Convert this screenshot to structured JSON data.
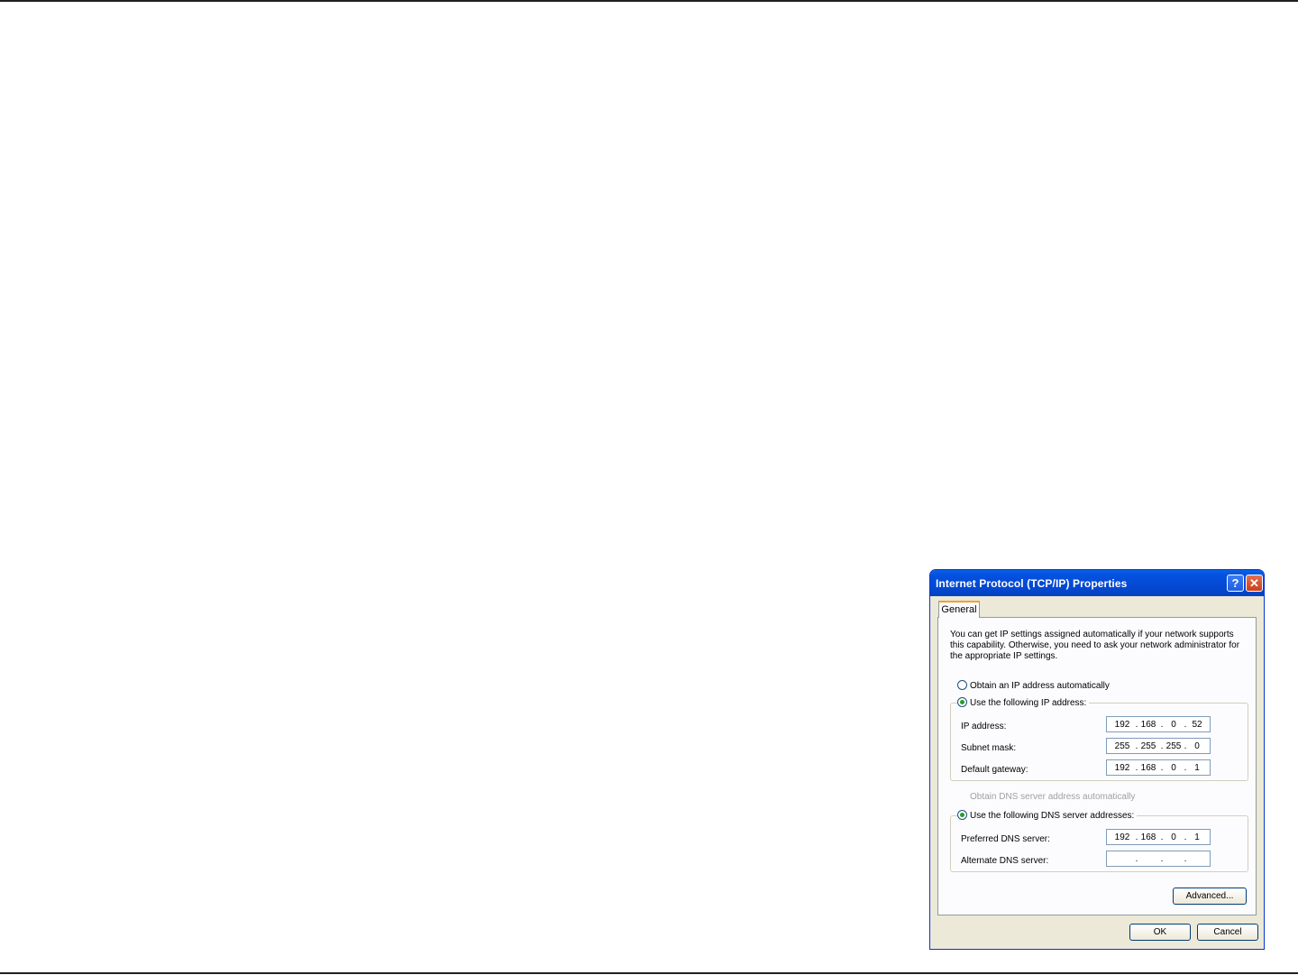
{
  "dialog": {
    "title": "Internet Protocol (TCP/IP) Properties",
    "help_label": "?",
    "close_label": "✕",
    "tab_label": "General",
    "description": "You can get IP settings assigned automatically if your network supports this capability. Otherwise, you need to ask your network administrator for the appropriate IP settings.",
    "radio_auto_ip": "Obtain an IP address automatically",
    "radio_manual_ip": "Use the following IP address:",
    "ip_address_label": "IP address:",
    "ip_address": [
      "192",
      "168",
      "0",
      "52"
    ],
    "subnet_mask_label": "Subnet mask:",
    "subnet_mask": [
      "255",
      "255",
      "255",
      "0"
    ],
    "gateway_label": "Default gateway:",
    "gateway": [
      "192",
      "168",
      "0",
      "1"
    ],
    "radio_auto_dns": "Obtain DNS server address automatically",
    "radio_manual_dns": "Use the following DNS server addresses:",
    "preferred_dns_label": "Preferred DNS server:",
    "preferred_dns": [
      "192",
      "168",
      "0",
      "1"
    ],
    "alternate_dns_label": "Alternate DNS server:",
    "alternate_dns": [
      "",
      "",
      "",
      ""
    ],
    "advanced_label": "Advanced...",
    "ok_label": "OK",
    "cancel_label": "Cancel"
  }
}
